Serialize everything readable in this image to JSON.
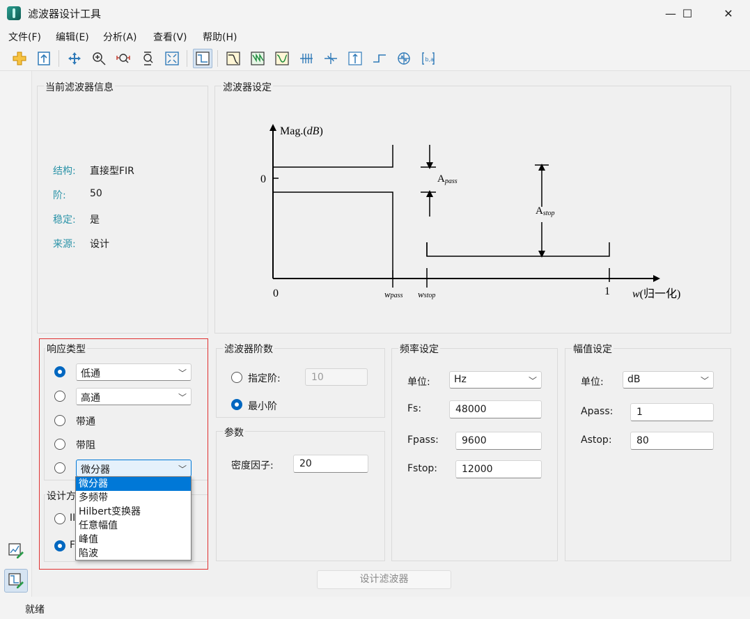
{
  "window": {
    "title": "滤波器设计工具",
    "minimize_glyph": "—",
    "maximize_glyph": "☐",
    "close_glyph": "✕"
  },
  "menu": [
    "文件(F)",
    "编辑(E)",
    "分析(A)",
    "查看(V)",
    "帮助(H)"
  ],
  "toolbar_icons": [
    "new-session-icon",
    "export-icon",
    "pan-icon",
    "zoom-in-icon",
    "zoom-x-icon",
    "zoom-y-icon",
    "fit-view-icon",
    "filter-spec-icon",
    "magnitude-response-icon",
    "phase-response-icon",
    "mag-phase-icon",
    "group-delay-icon",
    "phase-delay-icon",
    "impulse-response-icon",
    "step-response-icon",
    "pole-zero-icon",
    "coefficients-icon"
  ],
  "filter_info": {
    "title": "当前滤波器信息",
    "rows": [
      {
        "label": "结构:",
        "value": "直接型FIR"
      },
      {
        "label": "阶:",
        "value": "50"
      },
      {
        "label": "稳定:",
        "value": "是"
      },
      {
        "label": "来源:",
        "value": "设计"
      }
    ]
  },
  "filter_spec": {
    "title": "滤波器设定",
    "y_axis_label": "Mag.(dB)",
    "y_axis_label_main": "Mag.(",
    "y_axis_label_italic": "dB",
    "y_axis_label_end": ")",
    "zero_y": "0",
    "zero_x": "0",
    "one_x": "1",
    "apass_main": "A",
    "apass_sub": "pass",
    "astop_main": "A",
    "astop_sub": "stop",
    "wpass": "wpass",
    "wpass_main": "w",
    "wpass_sub": "pass",
    "wstop_main": "w",
    "wstop_sub": "stop",
    "x_axis_label_w": "w",
    "x_axis_label_rest": "(归一化)"
  },
  "response_type": {
    "title": "响应类型",
    "options": [
      {
        "label": "低通",
        "kind": "combo",
        "checked": true
      },
      {
        "label": "高通",
        "kind": "combo",
        "checked": false
      },
      {
        "label": "带通",
        "kind": "text",
        "checked": false
      },
      {
        "label": "带阻",
        "kind": "text",
        "checked": false
      },
      {
        "label": "微分器",
        "kind": "combo",
        "checked": false
      }
    ],
    "dropdown": {
      "items": [
        "微分器",
        "多频带",
        "Hilbert变换器",
        "任意幅值",
        "峰值",
        "陷波"
      ],
      "selected_index": 0
    }
  },
  "design_method": {
    "title_visible": "设计方",
    "options": [
      {
        "label_visible": "II",
        "checked": false
      },
      {
        "label_visible": "F",
        "checked": true
      }
    ]
  },
  "filter_order": {
    "title": "滤波器阶数",
    "specify_label": "指定阶:",
    "specify_value": "10",
    "minimum_label": "最小阶",
    "minimum_checked": true
  },
  "params": {
    "title": "参数",
    "density_label": "密度因子:",
    "density_value": "20"
  },
  "freq": {
    "title": "频率设定",
    "unit_label": "单位:",
    "unit_value": "Hz",
    "fs_label": "Fs:",
    "fs_value": "48000",
    "fpass_label": "Fpass:",
    "fpass_value": "9600",
    "fstop_label": "Fstop:",
    "fstop_value": "12000"
  },
  "mag": {
    "title": "幅值设定",
    "unit_label": "单位:",
    "unit_value": "dB",
    "apass_label": "Apass:",
    "apass_value": "1",
    "astop_label": "Astop:",
    "astop_value": "80"
  },
  "design_button": "设计滤波器",
  "status": "就绪",
  "colors": {
    "accent": "#0067c0",
    "info_label": "#2b93a8",
    "highlight": "#e03030",
    "selection": "#0078d7"
  }
}
